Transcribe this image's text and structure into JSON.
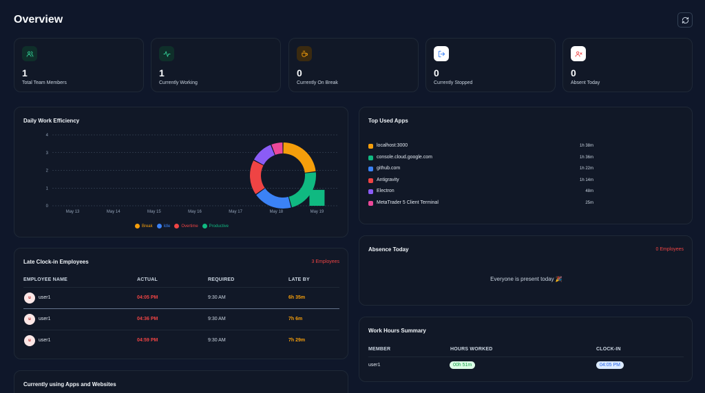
{
  "page": {
    "title": "Overview"
  },
  "stats": [
    {
      "value": "1",
      "label": "Total Team Members",
      "icon": "users-icon",
      "color": "#34d399",
      "bg": "#0f2f2a"
    },
    {
      "value": "1",
      "label": "Currently Working",
      "icon": "activity-icon",
      "color": "#34d399",
      "bg": "#0f2f2a"
    },
    {
      "value": "0",
      "label": "Currently On Break",
      "icon": "coffee-icon",
      "color": "#f59e0b",
      "bg": "#3a2a10"
    },
    {
      "value": "0",
      "label": "Currently Stopped",
      "icon": "logout-icon",
      "color": "#3b82f6",
      "bg": "#ffffff"
    },
    {
      "value": "0",
      "label": "Absent Today",
      "icon": "user-x-icon",
      "color": "#ef4444",
      "bg": "#ffffff"
    }
  ],
  "efficiency": {
    "title": "Daily Work Efficiency",
    "chart_data": {
      "type": "bar",
      "categories": [
        "May 13",
        "May 14",
        "May 15",
        "May 16",
        "May 17",
        "May 18",
        "May 19"
      ],
      "y_ticks": [
        "0",
        "1",
        "2",
        "3",
        "4"
      ],
      "ylim": [
        0,
        4
      ],
      "grid": true,
      "legend_position": "bottom",
      "series": [
        {
          "name": "Break",
          "color": "#f59e0b",
          "values": [
            0,
            0,
            0,
            0,
            0,
            0,
            0
          ]
        },
        {
          "name": "Idle",
          "color": "#3b82f6",
          "values": [
            0,
            0,
            0,
            0,
            0,
            0,
            0
          ]
        },
        {
          "name": "Overtime",
          "color": "#ef4444",
          "values": [
            0,
            0,
            0,
            0,
            0,
            0,
            0
          ]
        },
        {
          "name": "Productive",
          "color": "#10b981",
          "values": [
            0,
            0,
            0,
            0,
            0,
            0,
            0.9
          ]
        }
      ]
    }
  },
  "top_apps": {
    "title": "Top Used Apps",
    "apps": [
      {
        "name": "localhost:3000",
        "duration": "1h 38m",
        "color": "#f59e0b",
        "minutes": 98
      },
      {
        "name": "console.cloud.google.com",
        "duration": "1h 36m",
        "color": "#10b981",
        "minutes": 96
      },
      {
        "name": "github.com",
        "duration": "1h 22m",
        "color": "#3b82f6",
        "minutes": 82
      },
      {
        "name": "Antigravity",
        "duration": "1h 14m",
        "color": "#ef4444",
        "minutes": 74
      },
      {
        "name": "Electron",
        "duration": "48m",
        "color": "#8b5cf6",
        "minutes": 48
      },
      {
        "name": "MetaTrader 5 Client Terminal",
        "duration": "25m",
        "color": "#ec4899",
        "minutes": 25
      }
    ]
  },
  "late": {
    "title": "Late Clock-in Employees",
    "badge": "3 Employees",
    "headers": [
      "EMPLOYEE NAME",
      "ACTUAL",
      "REQUIRED",
      "LATE BY"
    ],
    "rows": [
      {
        "avatar": "u",
        "name": "user1",
        "actual": "04:05 PM",
        "required": "9:30 AM",
        "late_by": "6h 35m"
      },
      {
        "avatar": "u",
        "name": "user1",
        "actual": "04:36 PM",
        "required": "9:30 AM",
        "late_by": "7h 6m"
      },
      {
        "avatar": "u",
        "name": "user1",
        "actual": "04:59 PM",
        "required": "9:30 AM",
        "late_by": "7h 29m"
      }
    ]
  },
  "absence": {
    "title": "Absence Today",
    "badge": "0 Employees",
    "message": "Everyone is present today 🎉"
  },
  "work_hours": {
    "title": "Work Hours Summary",
    "headers": [
      "MEMBER",
      "HOURS WORKED",
      "CLOCK-IN"
    ],
    "rows": [
      {
        "member": "user1",
        "hours": "00h 51m",
        "clock_in": "04:05 PM"
      }
    ]
  },
  "apps_websites": {
    "title": "Currently using Apps and Websites"
  }
}
